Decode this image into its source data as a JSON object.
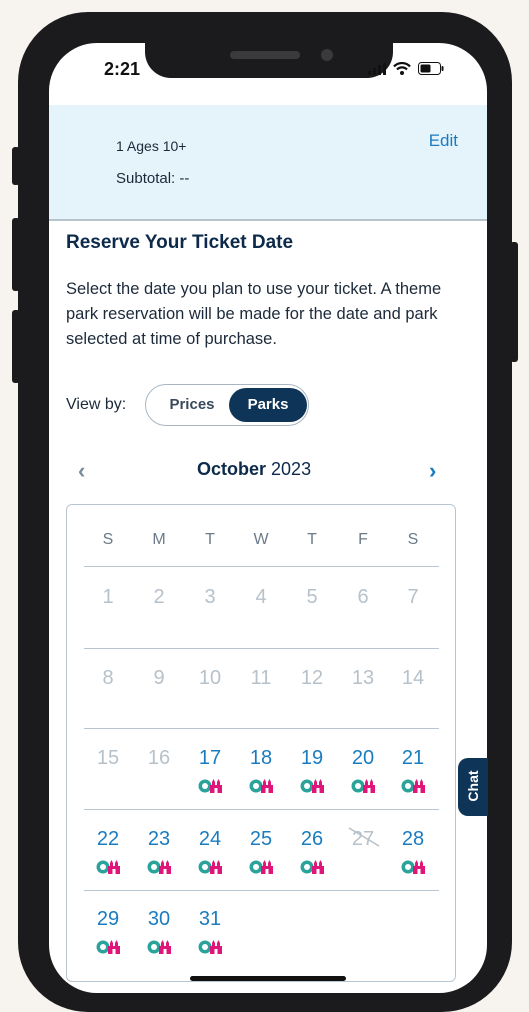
{
  "status_bar": {
    "time": "2:21"
  },
  "summary": {
    "ticket_line": "1 Ages 10+",
    "subtotal": "Subtotal: --",
    "edit_label": "Edit"
  },
  "heading": "Reserve Your Ticket Date",
  "description": " Select the date you plan to use your ticket. A theme park reservation will be made for the date and park selected at time of purchase.",
  "view_by": {
    "label": "View by:",
    "options": [
      "Prices",
      "Parks"
    ],
    "selected": "Parks"
  },
  "calendar": {
    "month": "October",
    "year": "2023",
    "weekdays": [
      "S",
      "M",
      "T",
      "W",
      "T",
      "F",
      "S"
    ],
    "days": [
      {
        "day": "1",
        "state": "unavailable"
      },
      {
        "day": "2",
        "state": "unavailable"
      },
      {
        "day": "3",
        "state": "unavailable"
      },
      {
        "day": "4",
        "state": "unavailable"
      },
      {
        "day": "5",
        "state": "unavailable"
      },
      {
        "day": "6",
        "state": "unavailable"
      },
      {
        "day": "7",
        "state": "unavailable"
      },
      {
        "day": "8",
        "state": "unavailable"
      },
      {
        "day": "9",
        "state": "unavailable"
      },
      {
        "day": "10",
        "state": "unavailable"
      },
      {
        "day": "11",
        "state": "unavailable"
      },
      {
        "day": "12",
        "state": "unavailable"
      },
      {
        "day": "13",
        "state": "unavailable"
      },
      {
        "day": "14",
        "state": "unavailable"
      },
      {
        "day": "15",
        "state": "unavailable"
      },
      {
        "day": "16",
        "state": "unavailable"
      },
      {
        "day": "17",
        "state": "available"
      },
      {
        "day": "18",
        "state": "available"
      },
      {
        "day": "19",
        "state": "available"
      },
      {
        "day": "20",
        "state": "available"
      },
      {
        "day": "21",
        "state": "available"
      },
      {
        "day": "22",
        "state": "available"
      },
      {
        "day": "23",
        "state": "available"
      },
      {
        "day": "24",
        "state": "available"
      },
      {
        "day": "25",
        "state": "available"
      },
      {
        "day": "26",
        "state": "available"
      },
      {
        "day": "27",
        "state": "sold-out"
      },
      {
        "day": "28",
        "state": "available"
      },
      {
        "day": "29",
        "state": "available"
      },
      {
        "day": "30",
        "state": "available"
      },
      {
        "day": "31",
        "state": "available"
      }
    ]
  },
  "chat_label": "Chat",
  "colors": {
    "accent": "#1a7cbf",
    "navy": "#0e3557",
    "summary_bg": "#e5f3fb",
    "park_teal": "#2aa39b",
    "park_pink": "#e0157a"
  },
  "icons": {
    "park": "park-availability-icon",
    "prev": "chevron-left-icon",
    "next": "chevron-right-icon"
  }
}
